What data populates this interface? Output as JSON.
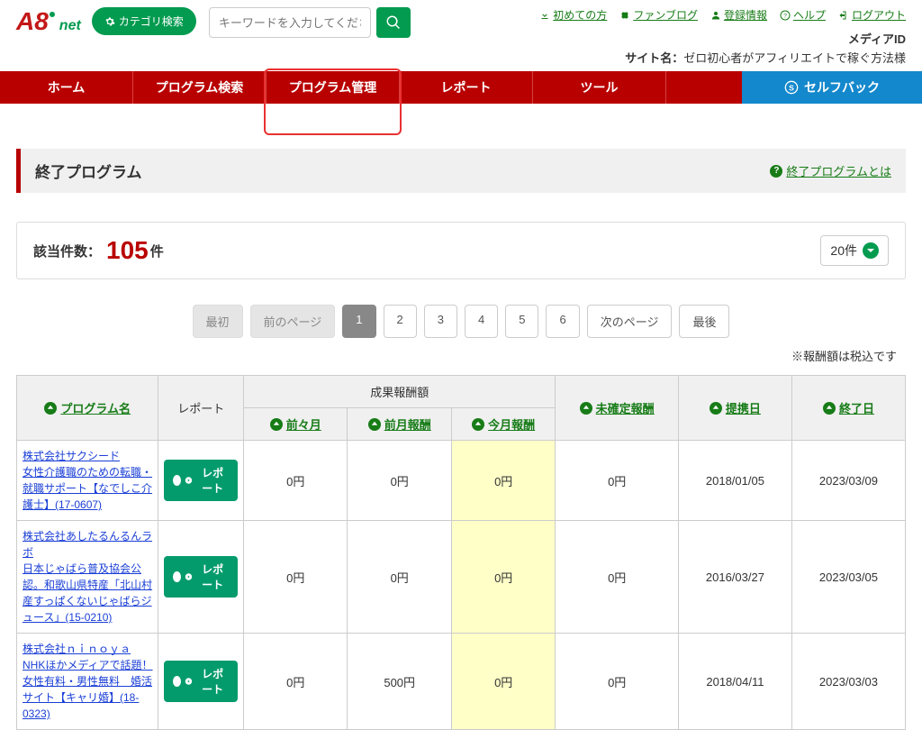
{
  "top_links": {
    "beginner": "初めての方",
    "fanblog": "ファンブログ",
    "register": "登録情報",
    "help": "ヘルプ",
    "logout": "ログアウト"
  },
  "header": {
    "category_btn": "カテゴリ検索",
    "search_placeholder": "キーワードを入力してください",
    "media_id_label": "メディアID",
    "media_id_value": "",
    "site_label": "サイト名：",
    "site_value": "ゼロ初心者がアフィリエイトで稼ぐ方法様"
  },
  "nav": {
    "home": "ホーム",
    "search": "プログラム検索",
    "manage": "プログラム管理",
    "report": "レポート",
    "tool": "ツール",
    "selfback": "セルフバック"
  },
  "section": {
    "title": "終了プログラム",
    "help_link": "終了プログラムとは"
  },
  "counts": {
    "label": "該当件数：",
    "value": "105",
    "unit": "件",
    "per_page": "20件"
  },
  "pagination": {
    "first": "最初",
    "prev": "前のページ",
    "p1": "1",
    "p2": "2",
    "p3": "3",
    "p4": "4",
    "p5": "5",
    "p6": "6",
    "next": "次のページ",
    "last": "最後"
  },
  "tax_note": "※報酬額は税込です",
  "table": {
    "headers": {
      "program": "プログラム名",
      "report": "レポート",
      "reward_group": "成果報酬額",
      "two_months_ago": "前々月",
      "last_month": "前月報酬",
      "this_month": "今月報酬",
      "unconfirmed": "未確定報酬",
      "partner_date": "提携日",
      "end_date": "終了日"
    },
    "report_btn": "レポート",
    "rows": [
      {
        "program": "株式会社サクシード\n女性介護職のための転職・就職サポート【なでしこ介護士】(17-0607)",
        "m2": "0円",
        "m1": "0円",
        "m0": "0円",
        "unconf": "0円",
        "pdate": "2018/01/05",
        "edate": "2023/03/09"
      },
      {
        "program": "株式会社あしたるんるんラボ\n日本じゃばら普及協会公認。和歌山県特産「北山村産すっぱくないじゃばらジュース」(15-0210)",
        "m2": "0円",
        "m1": "0円",
        "m0": "0円",
        "unconf": "0円",
        "pdate": "2016/03/27",
        "edate": "2023/03/05"
      },
      {
        "program": "株式会社ｎｉｎｏｙａ\nNHKほかメディアで話題！女性有料・男性無料　婚活サイト【キャリ婚】(18-0323)",
        "m2": "0円",
        "m1": "500円",
        "m0": "0円",
        "unconf": "0円",
        "pdate": "2018/04/11",
        "edate": "2023/03/03"
      }
    ]
  }
}
